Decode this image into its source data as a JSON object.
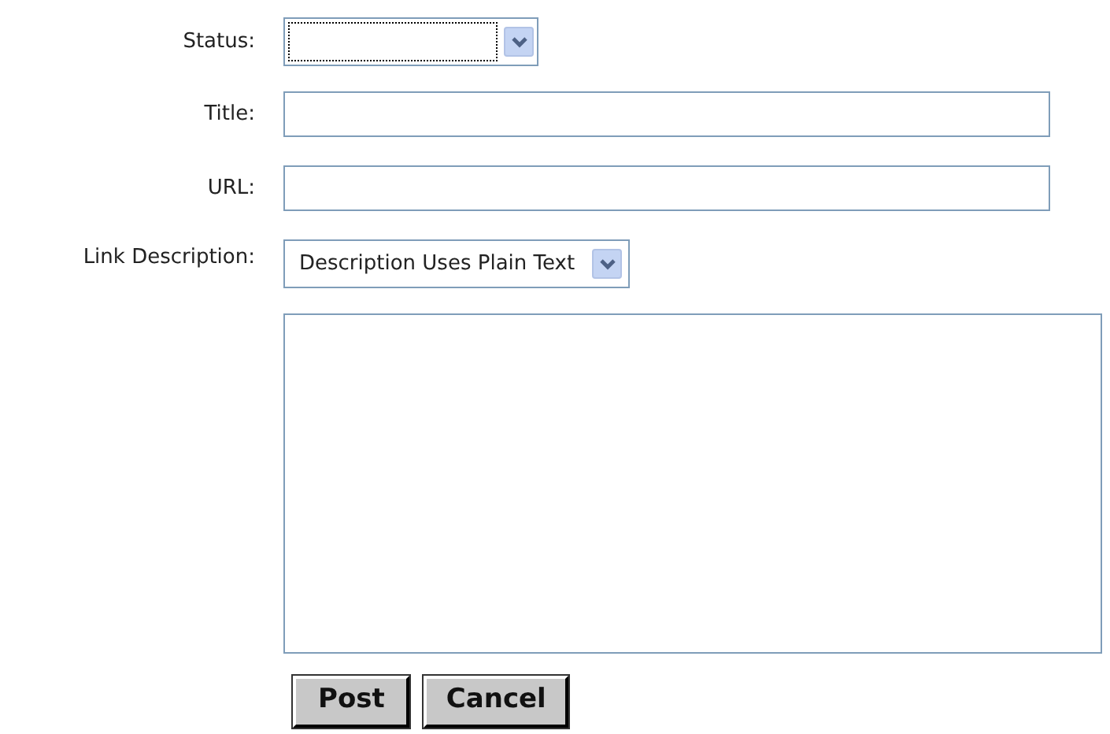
{
  "fields": [
    {
      "kind": "select",
      "label": "Status:",
      "focused": true
    },
    {
      "kind": "text",
      "label": "Title:"
    },
    {
      "kind": "text",
      "label": "URL:"
    },
    {
      "kind": "select",
      "label": "Link Description:",
      "value": "Description Uses Plain Text",
      "focused": false
    },
    {
      "kind": "textarea"
    }
  ],
  "buttons": [
    "Post",
    "Cancel"
  ]
}
